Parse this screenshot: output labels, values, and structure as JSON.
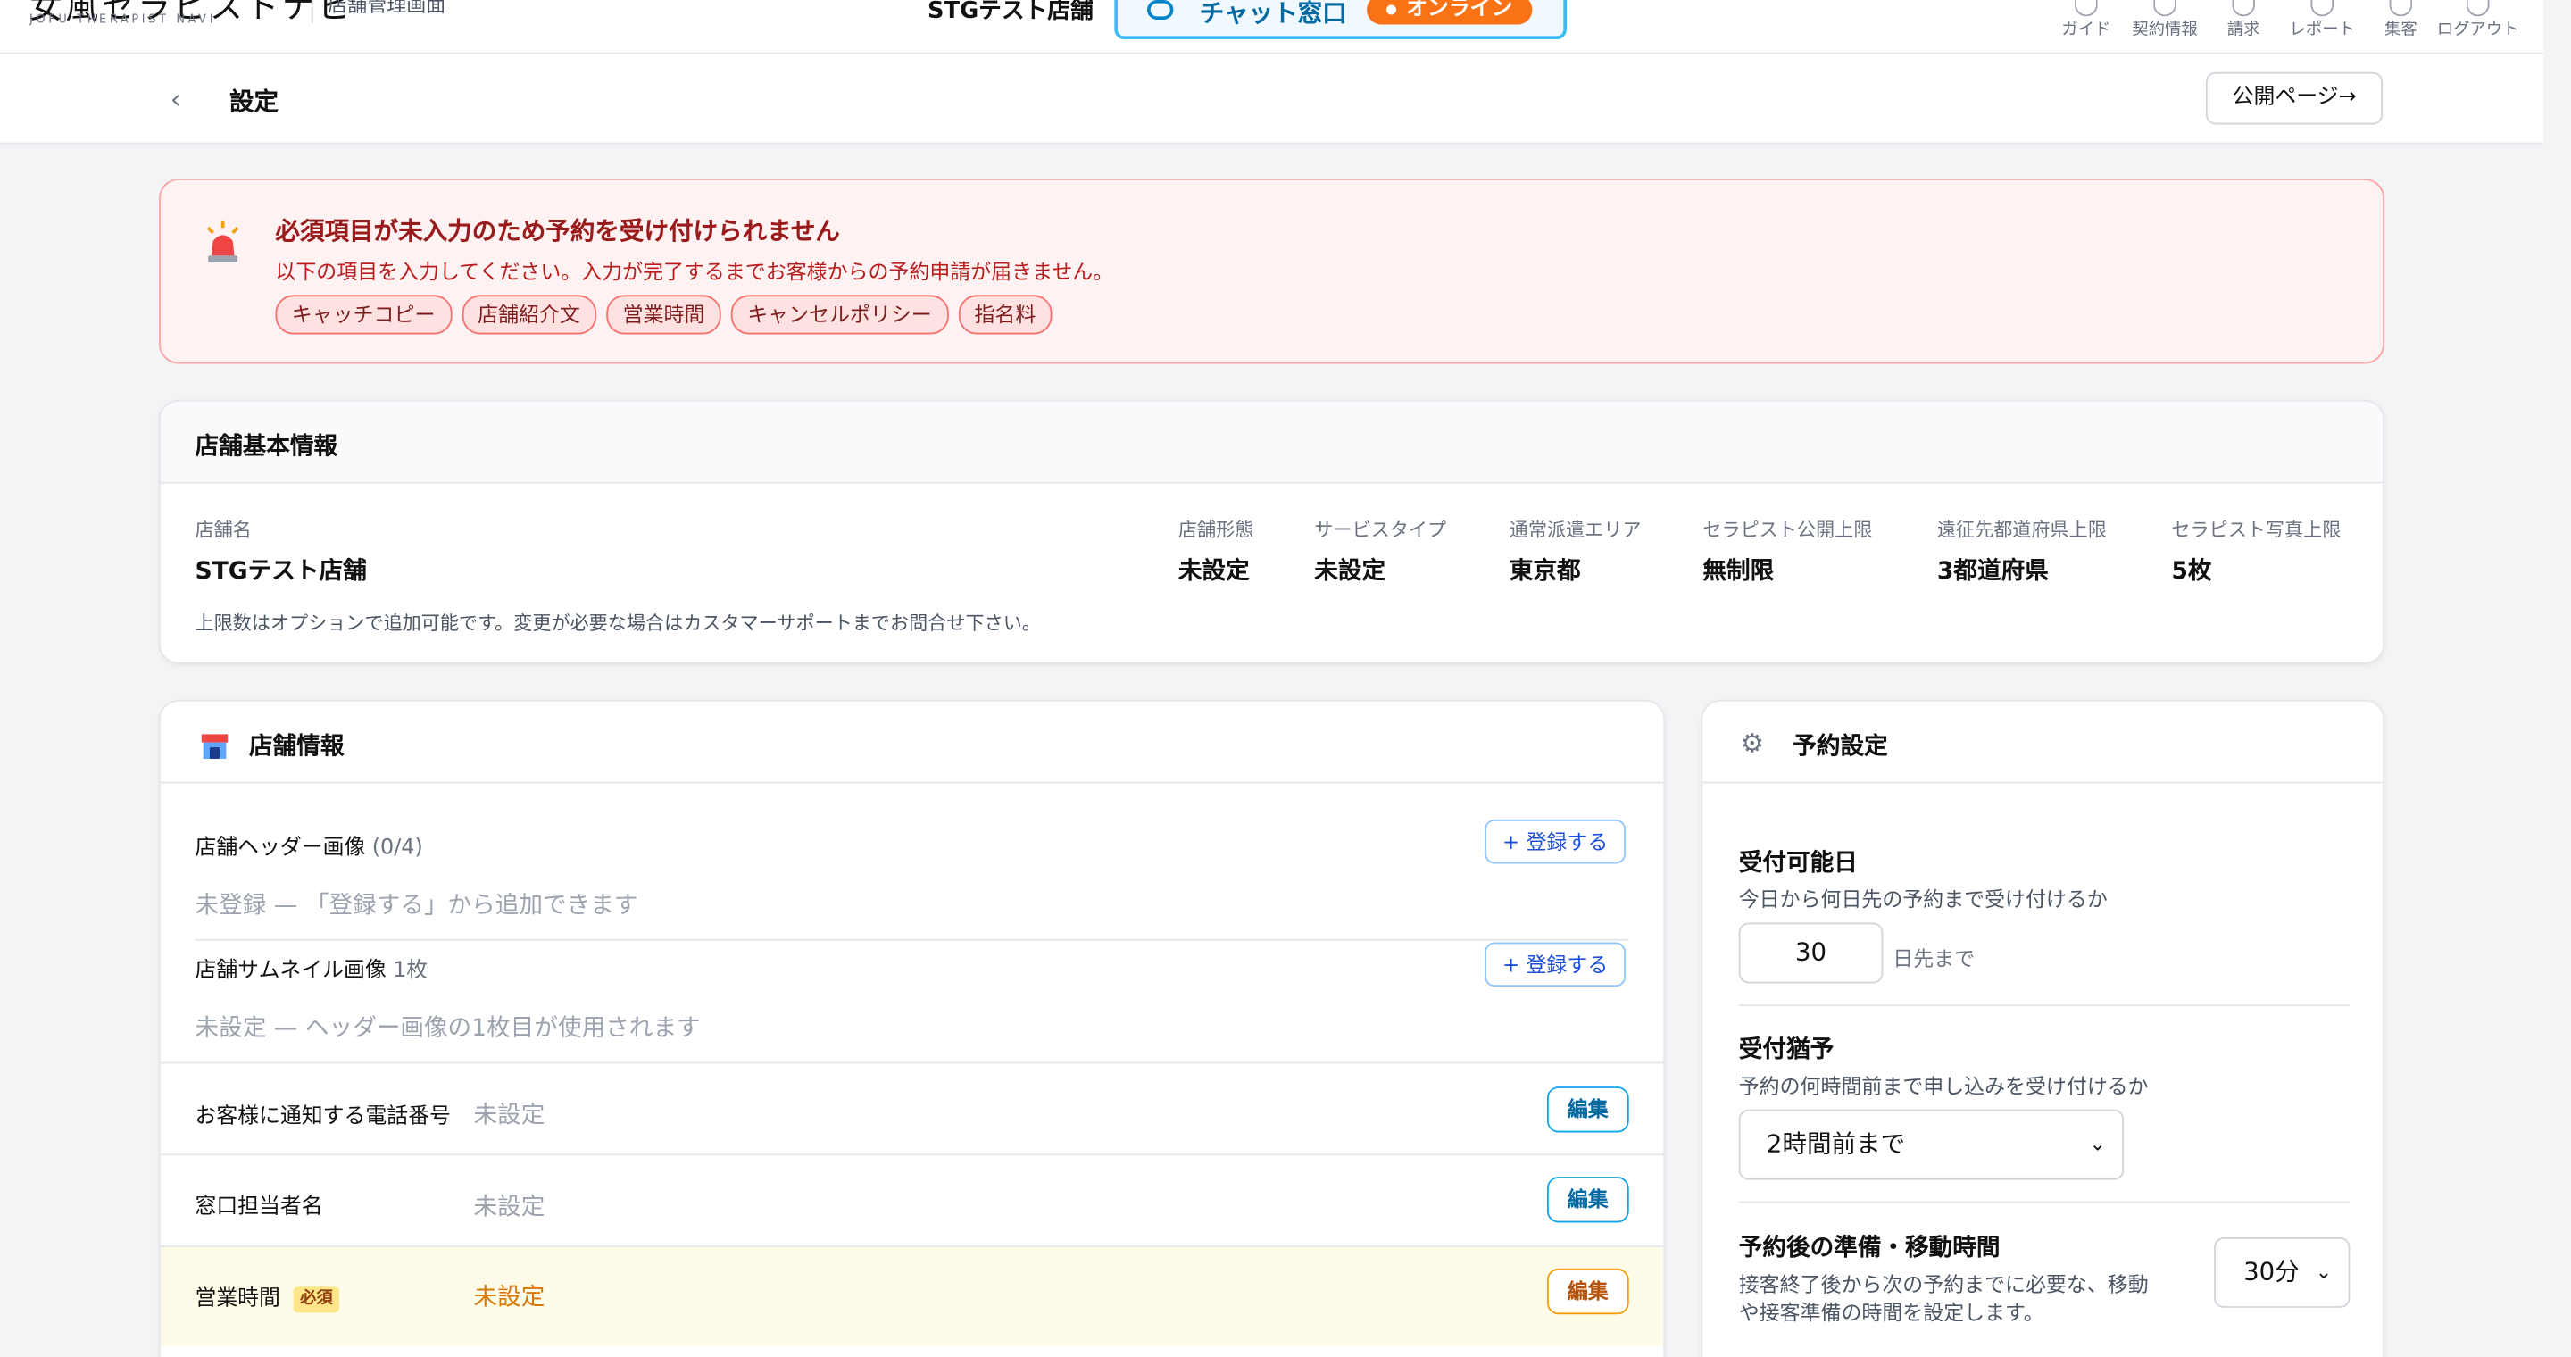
{
  "header": {
    "logo_text": "女風セラピストナビ",
    "logo_sub": "JOFU THERAPIST NAVI",
    "admin_label": "店舗管理画面",
    "store_name": "STGテスト店舗",
    "chat_label": "チャット窓口",
    "online_label": "オンライン",
    "nav": [
      {
        "label": "ガイド",
        "icon": "guide-icon"
      },
      {
        "label": "契約情報",
        "icon": "contract-icon"
      },
      {
        "label": "請求",
        "icon": "billing-icon"
      },
      {
        "label": "レポート",
        "icon": "report-icon"
      },
      {
        "label": "集客",
        "icon": "marketing-icon"
      },
      {
        "label": "ログアウト",
        "icon": "logout-icon"
      }
    ]
  },
  "subheader": {
    "title": "設定",
    "public_page_label": "公開ページ→"
  },
  "alert": {
    "title": "必須項目が未入力のため予約を受け付けられません",
    "description": "以下の項目を入力してください。入力が完了するまでお客様からの予約申請が届きません。",
    "chips": [
      "キャッチコピー",
      "店舗紹介文",
      "営業時間",
      "キャンセルポリシー",
      "指名料"
    ]
  },
  "basic_info": {
    "title": "店舗基本情報",
    "store_name_label": "店舗名",
    "store_name_value": "STGテスト店舗",
    "columns": [
      {
        "label": "店舗形態",
        "value": "未設定"
      },
      {
        "label": "サービスタイプ",
        "value": "未設定"
      },
      {
        "label": "通常派遣エリア",
        "value": "東京都"
      },
      {
        "label": "セラピスト公開上限",
        "value": "無制限"
      },
      {
        "label": "遠征先都道府県上限",
        "value": "3都道府県"
      },
      {
        "label": "セラピスト写真上限",
        "value": "5枚"
      }
    ],
    "note": "上限数はオプションで追加可能です。変更が必要な場合はカスタマーサポートまでお問合せ下さい。"
  },
  "store_info": {
    "title": "店舗情報",
    "header_image": {
      "label": "店舗ヘッダー画像",
      "count": "(0/4)",
      "button": "+ 登録する",
      "empty": "未登録 — 「登録する」から追加できます"
    },
    "thumbnail": {
      "label": "店舗サムネイル画像",
      "count": "1枚",
      "button": "+ 登録する",
      "empty": "未設定 — ヘッダー画像の1枚目が使用されます"
    },
    "phone": {
      "label": "お客様に通知する電話番号",
      "value": "未設定",
      "button": "編集"
    },
    "contact": {
      "label": "窓口担当者名",
      "value": "未設定",
      "button": "編集"
    },
    "hours": {
      "label": "営業時間",
      "badge": "必須",
      "value": "未設定",
      "button": "編集"
    }
  },
  "reservation": {
    "title": "予約設定",
    "acceptable_days": {
      "title": "受付可能日",
      "desc": "今日から何日先の予約まで受け付けるか",
      "value": "30",
      "suffix": "日先まで"
    },
    "grace": {
      "title": "受付猶予",
      "desc": "予約の何時間前まで申し込みを受け付けるか",
      "value": "2時間前まで"
    },
    "prep": {
      "title": "予約後の準備・移動時間",
      "desc1": "接客終了後から次の予約までに必要な、移動",
      "desc2": "や接客準備の時間を設定します。",
      "value": "30分"
    }
  }
}
